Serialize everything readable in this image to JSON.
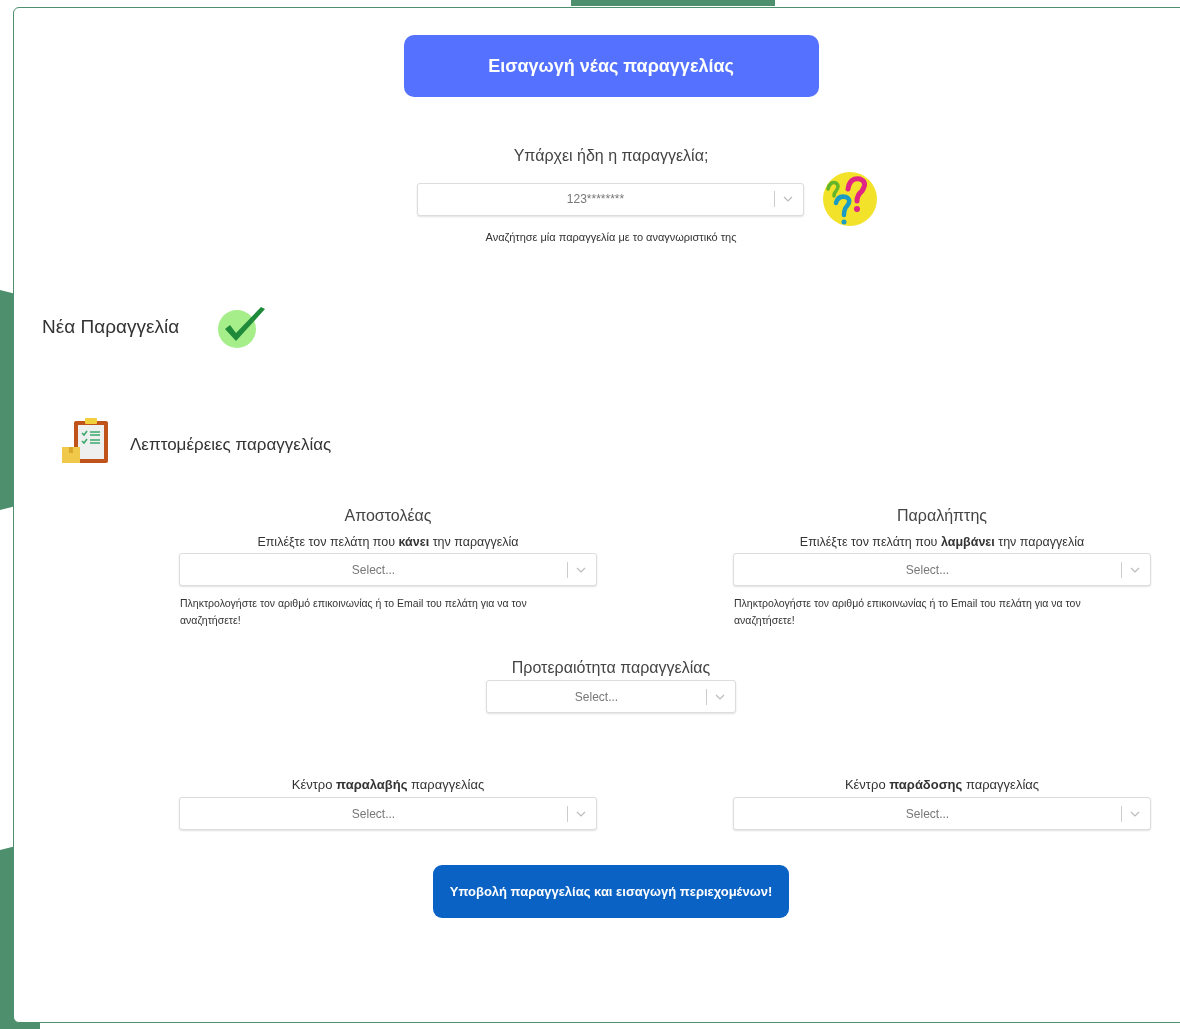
{
  "header_button": "Εισαγωγή νέας παραγγελίας",
  "lookup": {
    "label": "Υπάρχει ήδη η παραγγελία;",
    "value": "123********",
    "hint": "Αναζήτησε μία παραγγελία με το αναγνωριστικό της"
  },
  "new_order": {
    "title": "Νέα Παραγγελία"
  },
  "details": {
    "title": "Λεπτομέρειες παραγγελίας"
  },
  "parties": [
    {
      "title": "Αποστολέας",
      "subtitle": "Επιλέξτε τον πελάτη που **κάνει** την παραγγελία",
      "placeholder": "Select...",
      "hint": "Πληκτρολογήστε τον αριθμό επικοινωνίας ή το Email του πελάτη για να τον αναζητήσετε!"
    },
    {
      "title": "Παραλήπτης",
      "subtitle": "Επιλέξτε τον πελάτη που **λαμβάνει** την παραγγελία",
      "placeholder": "Select...",
      "hint": "Πληκτρολογήστε τον αριθμό επικοινωνίας ή το Email του πελάτη για να τον αναζητήσετε!"
    }
  ],
  "priority": {
    "label": "Προτεραιότητα παραγγελίας",
    "placeholder": "Select..."
  },
  "centers": [
    {
      "label": "Κέντρο **παραλαβής** παραγγελίας",
      "placeholder": "Select..."
    },
    {
      "label": "Κέντρο **παράδοσης** παραγγελίας",
      "placeholder": "Select..."
    }
  ],
  "submit_button": "Υποβολή παραγγελίας και εισαγωγή περιεχομένων!"
}
